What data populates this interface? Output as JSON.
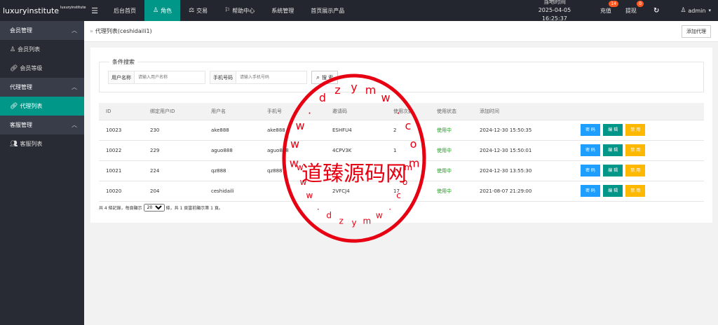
{
  "app": {
    "logo_text": "luxuryinstitute",
    "logo_sup": "luxuryinstitute"
  },
  "topnav": {
    "items": [
      {
        "label": "后台首页",
        "icon": ""
      },
      {
        "label": "角色",
        "icon": "user-icon"
      },
      {
        "label": "交易",
        "icon": "scale-icon"
      },
      {
        "label": "帮助中心",
        "icon": "flag-icon"
      },
      {
        "label": "系统管理",
        "icon": ""
      },
      {
        "label": "首页展示产品",
        "icon": ""
      }
    ],
    "time_label": "当地时间",
    "time_value": "2025-04-05 16:25:37",
    "recharge_label": "充值",
    "recharge_badge": "14",
    "withdraw_label": "提现",
    "withdraw_badge": "0",
    "user_name": "admin"
  },
  "sidebar": {
    "groups": [
      {
        "label": "会员管理",
        "items": [
          "会员列表",
          "会员等级"
        ]
      },
      {
        "label": "代理管理",
        "items": [
          "代理列表"
        ]
      },
      {
        "label": "客服管理",
        "items": [
          "客服列表"
        ]
      }
    ]
  },
  "breadcrumb": {
    "text": "代理列表(ceshidaili1)",
    "add_button": "添加代理"
  },
  "search": {
    "legend": "条件搜索",
    "username_label": "用户名称",
    "username_placeholder": "请输入用户名称",
    "phone_label": "手机号码",
    "phone_placeholder": "请输入手机号码",
    "button": "搜 索"
  },
  "table": {
    "columns": [
      "ID",
      "绑定用户ID",
      "用户名",
      "手机号",
      "邀请码",
      "使用次数",
      "使用状态",
      "添加时间"
    ],
    "rows": [
      {
        "id": "10023",
        "uid": "230",
        "name": "ake888",
        "phone": "ake888",
        "code": "ESHFU4",
        "count": "2",
        "status": "使用中",
        "time": "2024-12-30 15:50:35"
      },
      {
        "id": "10022",
        "uid": "229",
        "name": "aguo888",
        "phone": "aguo888",
        "code": "4CPV3K",
        "count": "1",
        "status": "使用中",
        "time": "2024-12-30 15:50:01"
      },
      {
        "id": "10021",
        "uid": "224",
        "name": "qz888",
        "phone": "qz888",
        "code": "",
        "count": "2",
        "status": "使用中",
        "time": "2024-12-30 13:55:30"
      },
      {
        "id": "10020",
        "uid": "204",
        "name": "ceshidaili",
        "phone": "",
        "code": "2VFCJ4",
        "count": "17",
        "status": "使用中",
        "time": "2021-08-07 21:29:00"
      }
    ],
    "actions": {
      "password": "密 码",
      "edit": "编 辑",
      "disable": "禁 用"
    }
  },
  "pager": {
    "prefix": "共 4 條記錄，每頁顯示",
    "per_page": "20",
    "suffix": "條，共 1 頁當前顯示第 1 頁。"
  },
  "watermark": {
    "center_text": "道臻源码网",
    "ring_top": [
      "w",
      "w",
      "w",
      ".",
      "d",
      "z",
      "y",
      "m",
      "w",
      ".",
      "c",
      "o",
      "m"
    ],
    "ring_bottom": [
      "w",
      "w",
      "w",
      ".",
      "d",
      "z",
      "y",
      "m",
      "w",
      ".",
      "c",
      "o",
      "m"
    ]
  },
  "colors": {
    "topbar": "#23262e",
    "sidebar": "#282b33",
    "accent": "#009688",
    "blue_btn": "#1e9fff",
    "yellow_btn": "#ffb800",
    "badge": "#ff5722",
    "watermark": "#e60012"
  }
}
